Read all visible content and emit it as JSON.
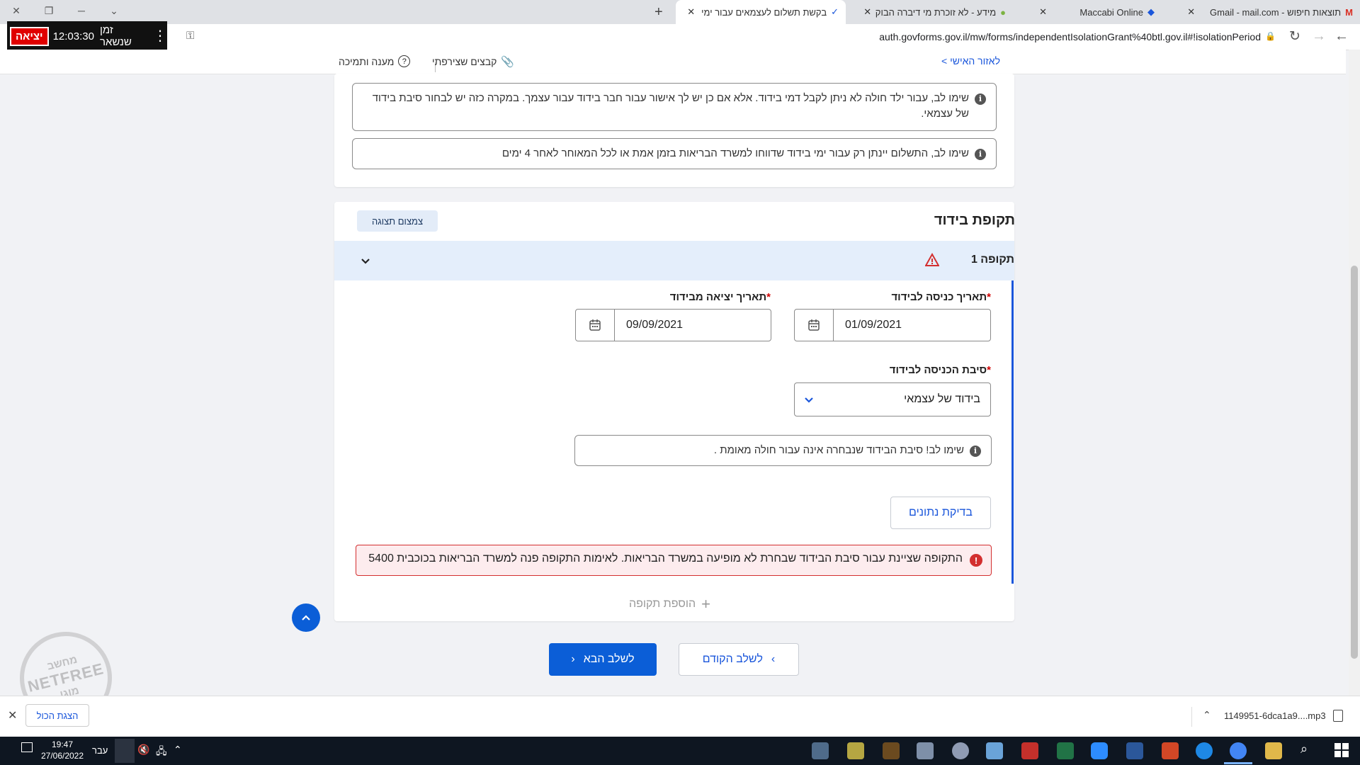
{
  "browser": {
    "tabs": [
      {
        "title": "תוצאות חיפוש - Gmail - mail.com"
      },
      {
        "title": "Maccabi Online"
      },
      {
        "title": "מידע - לא זוכרת מי דיברה הבוקר"
      },
      {
        "title": "בקשת תשלום לעצמאים עבור ימי"
      }
    ],
    "url": "auth.govforms.gov.il/mw/forms/independentIsolationGrant%40btl.gov.il#!isolationPeriod"
  },
  "timer": {
    "label": "זמן שנשאר",
    "value": "12:03:30",
    "exit_label": "יציאה"
  },
  "subheader": {
    "personal_area": "< לאזור האישי",
    "attachments": "קבצים שצירפתי",
    "support": "מענה ותמיכה"
  },
  "notices": {
    "child_notice": "שימו לב, עבור ילד חולה לא ניתן לקבל דמי בידוד. אלא אם כן יש לך אישור עבור חבר בידוד עבור עצמך. במקרה כזה יש לבחור סיבת בידוד של עצמאי.",
    "payment_notice": "שימו לב, התשלום יינתן רק עבור ימי בידוד שדווחו למשרד הבריאות בזמן אמת או לכל המאוחר לאחר 4 ימים"
  },
  "section": {
    "title": "תקופת בידוד",
    "compact_button": "צמצום תצוגה",
    "period_label": "תקופה 1",
    "entry_label": "תאריך כניסה לבידוד",
    "entry_value": "01/09/2021",
    "exit_label": "תאריך יציאה מבידוד",
    "exit_value": "09/09/2021",
    "reason_label": "סיבת הכניסה לבידוד",
    "reason_value": "בידוד של עצמאי",
    "reason_notice": "שימו לב! סיבת הבידוד שנבחרה אינה עבור חולה מאומת .",
    "check_button": "בדיקת נתונים",
    "error_text": "התקופה שציינת עבור סיבת הבידוד שבחרת לא מופיעה במשרד הבריאות. לאימות התקופה פנה למשרד הבריאות בכוכבית 5400",
    "add_period": "הוספת תקופה",
    "required_mark": "*"
  },
  "nav": {
    "next": "לשלב הבא",
    "prev": "לשלב הקודם"
  },
  "watermark": {
    "line1": "מחשב",
    "line2": "NETFREE",
    "line3": "מוגן"
  },
  "downloads": {
    "show_all": "הצגת הכול",
    "file": "1149951-6dca1a9....mp3"
  },
  "taskbar": {
    "time": "19:47",
    "date": "27/06/2022",
    "lang": "עבר"
  },
  "colors": {
    "primary": "#0b5ed7",
    "error": "#d32f2f",
    "period_bar": "#e4eefb"
  }
}
